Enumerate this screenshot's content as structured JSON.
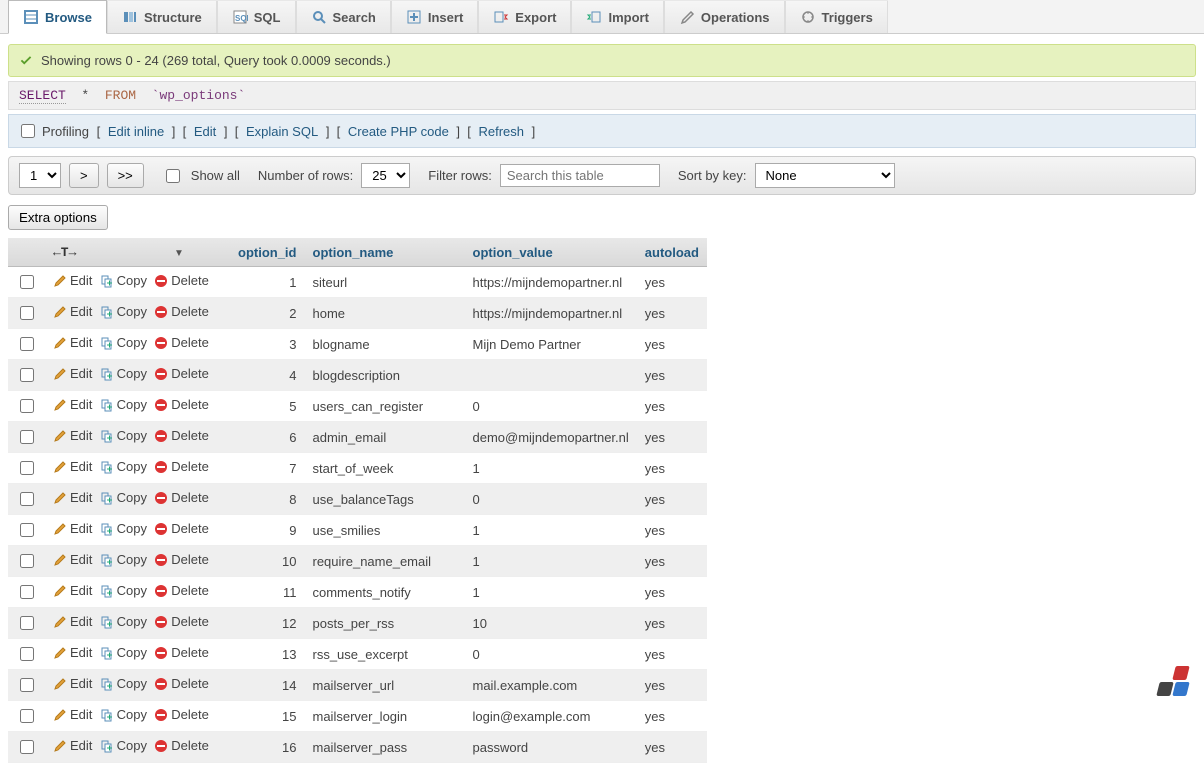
{
  "tabs": [
    {
      "label": "Browse",
      "active": true
    },
    {
      "label": "Structure"
    },
    {
      "label": "SQL"
    },
    {
      "label": "Search"
    },
    {
      "label": "Insert"
    },
    {
      "label": "Export"
    },
    {
      "label": "Import"
    },
    {
      "label": "Operations"
    },
    {
      "label": "Triggers"
    }
  ],
  "notice": "Showing rows 0 - 24 (269 total, Query took 0.0009 seconds.)",
  "sql": {
    "select": "SELECT",
    "star": "*",
    "from": "FROM",
    "table": "`wp_options`"
  },
  "linkbar": {
    "profiling": "Profiling",
    "editinline": "Edit inline",
    "edit": "Edit",
    "explain": "Explain SQL",
    "php": "Create PHP code",
    "refresh": "Refresh"
  },
  "controls": {
    "page": "1",
    "next": ">",
    "last": ">>",
    "showall": "Show all",
    "numrows_label": "Number of rows:",
    "numrows": "25",
    "filter_label": "Filter rows:",
    "filter_placeholder": "Search this table",
    "sort_label": "Sort by key:",
    "sort_value": "None"
  },
  "extra": "Extra options",
  "headers": {
    "arrows": "←T→",
    "option_id": "option_id",
    "option_name": "option_name",
    "option_value": "option_value",
    "autoload": "autoload"
  },
  "row_labels": {
    "edit": "Edit",
    "copy": "Copy",
    "delete": "Delete"
  },
  "rows": [
    {
      "id": 1,
      "name": "siteurl",
      "value": "https://mijndemopartner.nl",
      "autoload": "yes"
    },
    {
      "id": 2,
      "name": "home",
      "value": "https://mijndemopartner.nl",
      "autoload": "yes"
    },
    {
      "id": 3,
      "name": "blogname",
      "value": "Mijn Demo Partner",
      "autoload": "yes"
    },
    {
      "id": 4,
      "name": "blogdescription",
      "value": "",
      "autoload": "yes"
    },
    {
      "id": 5,
      "name": "users_can_register",
      "value": "0",
      "autoload": "yes"
    },
    {
      "id": 6,
      "name": "admin_email",
      "value": "demo@mijndemopartner.nl",
      "autoload": "yes"
    },
    {
      "id": 7,
      "name": "start_of_week",
      "value": "1",
      "autoload": "yes"
    },
    {
      "id": 8,
      "name": "use_balanceTags",
      "value": "0",
      "autoload": "yes"
    },
    {
      "id": 9,
      "name": "use_smilies",
      "value": "1",
      "autoload": "yes"
    },
    {
      "id": 10,
      "name": "require_name_email",
      "value": "1",
      "autoload": "yes"
    },
    {
      "id": 11,
      "name": "comments_notify",
      "value": "1",
      "autoload": "yes"
    },
    {
      "id": 12,
      "name": "posts_per_rss",
      "value": "10",
      "autoload": "yes"
    },
    {
      "id": 13,
      "name": "rss_use_excerpt",
      "value": "0",
      "autoload": "yes"
    },
    {
      "id": 14,
      "name": "mailserver_url",
      "value": "mail.example.com",
      "autoload": "yes"
    },
    {
      "id": 15,
      "name": "mailserver_login",
      "value": "login@example.com",
      "autoload": "yes"
    },
    {
      "id": 16,
      "name": "mailserver_pass",
      "value": "password",
      "autoload": "yes"
    }
  ]
}
